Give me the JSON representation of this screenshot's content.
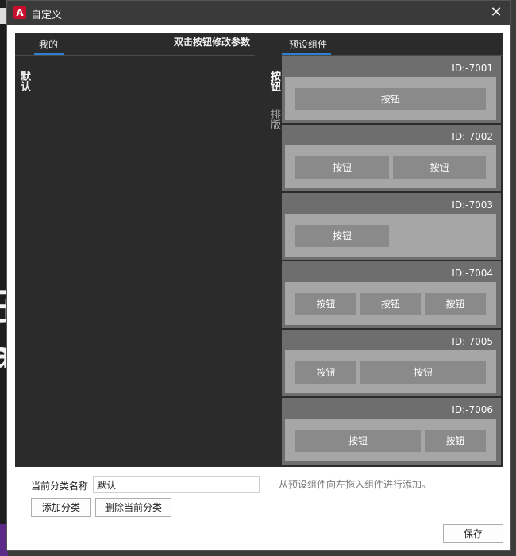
{
  "window": {
    "title": "自定义",
    "close_symbol": "✕",
    "app_icon_letter": "A"
  },
  "left": {
    "tab_label": "我的",
    "hint": "双击按钮修改参数",
    "categories": [
      "默认"
    ]
  },
  "vertical_tabs": {
    "buttons": "按钮",
    "layout": "排版"
  },
  "preset": {
    "tab_label": "预设组件",
    "blocks": [
      {
        "id": "ID:-7001",
        "buttons": [
          "按钮"
        ]
      },
      {
        "id": "ID:-7002",
        "buttons": [
          "按钮",
          "按钮"
        ]
      },
      {
        "id": "ID:-7003",
        "buttons": [
          "按钮"
        ]
      },
      {
        "id": "ID:-7004",
        "buttons": [
          "按钮",
          "按钮",
          "按钮"
        ]
      },
      {
        "id": "ID:-7005",
        "buttons": [
          "按钮",
          "按钮"
        ]
      },
      {
        "id": "ID:-7006",
        "buttons": [
          "按钮",
          "按钮"
        ]
      }
    ]
  },
  "form": {
    "category_name_label": "当前分类名称",
    "category_name_value": "默认",
    "add_category": "添加分类",
    "delete_category": "删除当前分类",
    "drag_hint": "从预设组件向左拖入组件进行添加。",
    "save": "保存"
  },
  "colors": {
    "accent": "#2f7fd1",
    "panel_bg": "#2b2b2b",
    "block_bg": "#6e6e6e",
    "button_bg": "#8a8a8a"
  }
}
